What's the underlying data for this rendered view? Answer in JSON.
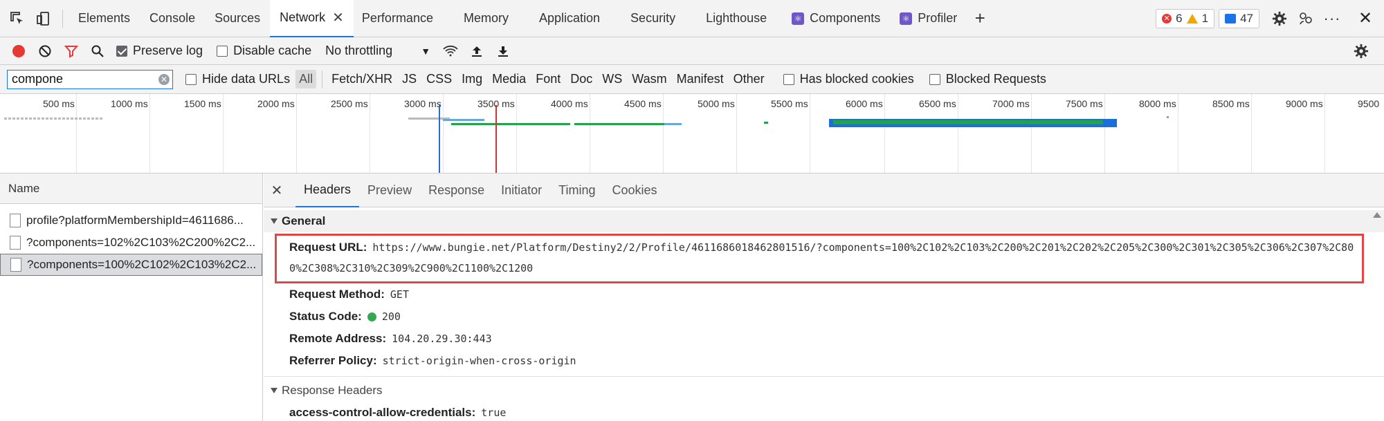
{
  "tabs": [
    {
      "label": "Elements"
    },
    {
      "label": "Console"
    },
    {
      "label": "Sources"
    },
    {
      "label": "Network"
    },
    {
      "label": "Performance"
    },
    {
      "label": "Memory"
    },
    {
      "label": "Application"
    },
    {
      "label": "Security"
    },
    {
      "label": "Lighthouse"
    },
    {
      "label": "Components"
    },
    {
      "label": "Profiler"
    }
  ],
  "badges": {
    "errors": "6",
    "warnings": "1",
    "messages": "47"
  },
  "toolbar": {
    "preserve_log": "Preserve log",
    "disable_cache": "Disable cache",
    "throttling": "No throttling"
  },
  "filter": {
    "value": "compone",
    "hide_data_urls": "Hide data URLs",
    "types": [
      "All",
      "Fetch/XHR",
      "JS",
      "CSS",
      "Img",
      "Media",
      "Font",
      "Doc",
      "WS",
      "Wasm",
      "Manifest",
      "Other"
    ],
    "has_blocked_cookies": "Has blocked cookies",
    "blocked_requests": "Blocked Requests"
  },
  "timeline": {
    "ticks": [
      "500 ms",
      "1000 ms",
      "1500 ms",
      "2000 ms",
      "2500 ms",
      "3000 ms",
      "3500 ms",
      "4000 ms",
      "4500 ms",
      "5000 ms",
      "5500 ms",
      "6000 ms",
      "6500 ms",
      "7000 ms",
      "7500 ms",
      "8000 ms",
      "8500 ms",
      "9000 ms",
      "9500"
    ]
  },
  "requests": {
    "header": "Name",
    "items": [
      {
        "name": "profile?platformMembershipId=4611686..."
      },
      {
        "name": "?components=102%2C103%2C200%2C2..."
      },
      {
        "name": "?components=100%2C102%2C103%2C2..."
      }
    ]
  },
  "detail": {
    "tabs": [
      "Headers",
      "Preview",
      "Response",
      "Initiator",
      "Timing",
      "Cookies"
    ],
    "general_title": "General",
    "request_url_label": "Request URL:",
    "request_url": "https://www.bungie.net/Platform/Destiny2/2/Profile/4611686018462801516/?components=100%2C102%2C103%2C200%2C201%2C202%2C205%2C300%2C301%2C305%2C306%2C307%2C800%2C308%2C310%2C309%2C900%2C1100%2C1200",
    "method_label": "Request Method:",
    "method": "GET",
    "status_label": "Status Code:",
    "status": "200",
    "remote_label": "Remote Address:",
    "remote": "104.20.29.30:443",
    "referrer_label": "Referrer Policy:",
    "referrer": "strict-origin-when-cross-origin",
    "response_headers_title": "Response Headers",
    "acac_label": "access-control-allow-credentials:",
    "acac": "true"
  }
}
